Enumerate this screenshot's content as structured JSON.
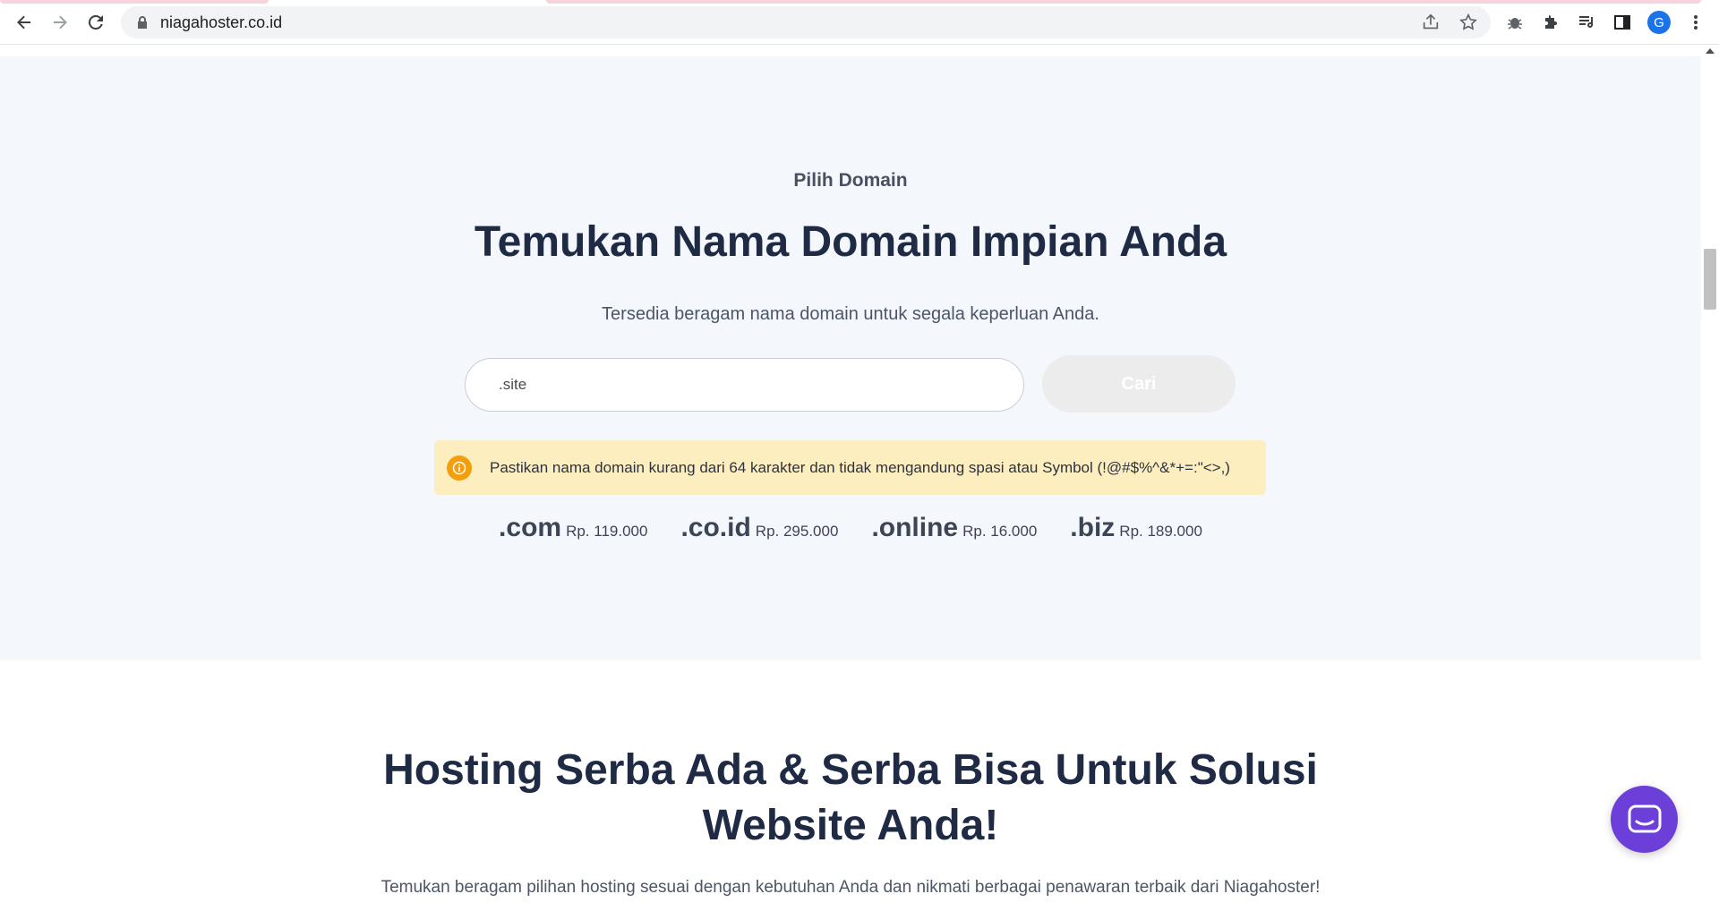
{
  "browser": {
    "url": "niagahoster.co.id",
    "avatar_letter": "G"
  },
  "domain_section": {
    "eyebrow": "Pilih Domain",
    "headline": "Temukan Nama Domain Impian Anda",
    "subtext": "Tersedia beragam nama domain untuk segala keperluan Anda.",
    "search_value": ".site",
    "search_button": "Cari",
    "alert_text": "Pastikan nama domain kurang dari 64 karakter dan tidak mengandung spasi atau Symbol (!@#$%^&*+=:\"<>,)",
    "tlds": [
      {
        "name": ".com",
        "price": "Rp. 119.000"
      },
      {
        "name": ".co.id",
        "price": "Rp. 295.000"
      },
      {
        "name": ".online",
        "price": "Rp. 16.000"
      },
      {
        "name": ".biz",
        "price": "Rp. 189.000"
      }
    ]
  },
  "hosting_section": {
    "title_line1": "Hosting Serba Ada & Serba Bisa Untuk Solusi",
    "title_line2": "Website Anda!",
    "description": "Temukan beragam pilihan hosting sesuai dengan kebutuhan Anda dan nikmati berbagai penawaran terbaik dari Niagahoster!"
  },
  "colors": {
    "section_bg": "#f4f8fc",
    "headline": "#1f2a44",
    "alert_bg": "#fdeec0",
    "alert_icon": "#f59e0b",
    "chat_button": "#6c3fd8",
    "search_button_bg": "#ececec"
  }
}
